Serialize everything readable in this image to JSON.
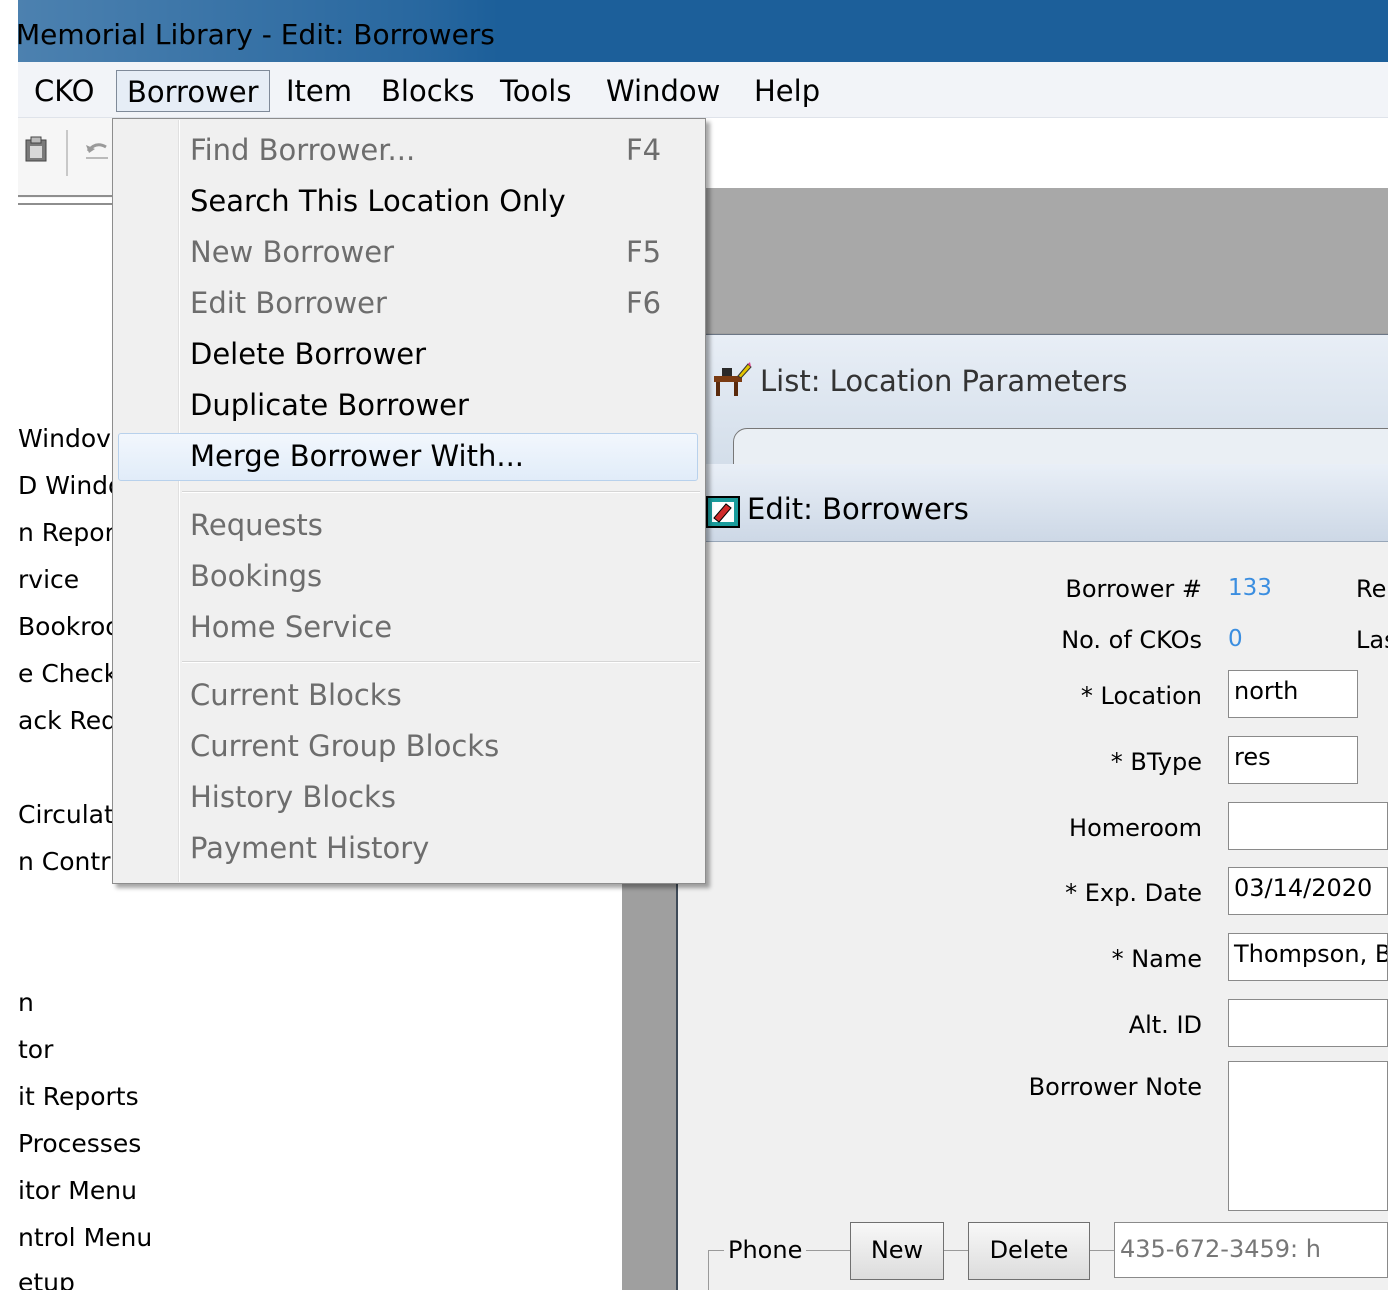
{
  "window": {
    "title": "Memorial Library - Edit: Borrowers"
  },
  "menubar": {
    "items": [
      "CKO",
      "Borrower",
      "Item",
      "Blocks",
      "Tools",
      "Window",
      "Help"
    ]
  },
  "left_panel": {
    "items": [
      "Windov",
      "D Windo",
      "n Repor",
      "rvice",
      "Bookroo",
      "e Check",
      "ack Requ",
      "Circulati",
      "n Contr",
      "n",
      "tor",
      "it Reports",
      "Processes",
      "itor Menu",
      "ntrol Menu",
      "etup"
    ]
  },
  "borrower_menu": {
    "items": [
      {
        "label": "Find Borrower...",
        "shortcut": "F4",
        "enabled": false
      },
      {
        "label": "Search This Location Only",
        "shortcut": "",
        "enabled": true
      },
      {
        "label": "New Borrower",
        "shortcut": "F5",
        "enabled": false
      },
      {
        "label": "Edit Borrower",
        "shortcut": "F6",
        "enabled": false
      },
      {
        "label": "Delete Borrower",
        "shortcut": "",
        "enabled": true
      },
      {
        "label": "Duplicate Borrower",
        "shortcut": "",
        "enabled": true
      },
      {
        "label": "Merge Borrower With...",
        "shortcut": "",
        "enabled": true,
        "highlighted": true
      },
      {
        "label": "Requests",
        "shortcut": "",
        "enabled": false
      },
      {
        "label": "Bookings",
        "shortcut": "",
        "enabled": false
      },
      {
        "label": "Home Service",
        "shortcut": "",
        "enabled": false
      },
      {
        "label": "Current Blocks",
        "shortcut": "",
        "enabled": false
      },
      {
        "label": "Current Group Blocks",
        "shortcut": "",
        "enabled": false
      },
      {
        "label": "History Blocks",
        "shortcut": "",
        "enabled": false
      },
      {
        "label": "Payment History",
        "shortcut": "",
        "enabled": false
      }
    ]
  },
  "list_window": {
    "title": "List: Location Parameters"
  },
  "edit_window": {
    "title": "Edit: Borrowers",
    "borrower_number_label": "Borrower #",
    "borrower_number": "133",
    "right_cut_1": "Re",
    "ckos_label": "No. of CKOs",
    "ckos": "0",
    "right_cut_2": "Las",
    "location_label": "* Location",
    "location": "north",
    "btype_label": "* BType",
    "btype": "res",
    "homeroom_label": "Homeroom",
    "homeroom": "",
    "exp_date_label": "* Exp. Date",
    "exp_date": "03/14/2020",
    "name_label": "* Name",
    "name": "Thompson, B",
    "alt_id_label": "Alt. ID",
    "alt_id": "",
    "note_label": "Borrower Note",
    "note": "",
    "phone_label": "Phone",
    "new_button": "New",
    "delete_button": "Delete",
    "phone_value": "435-672-3459: h"
  },
  "colors": {
    "titlebar": "#1c5f9a",
    "link_value": "#3b8ee0",
    "disabled_text": "#6d6d6d"
  }
}
